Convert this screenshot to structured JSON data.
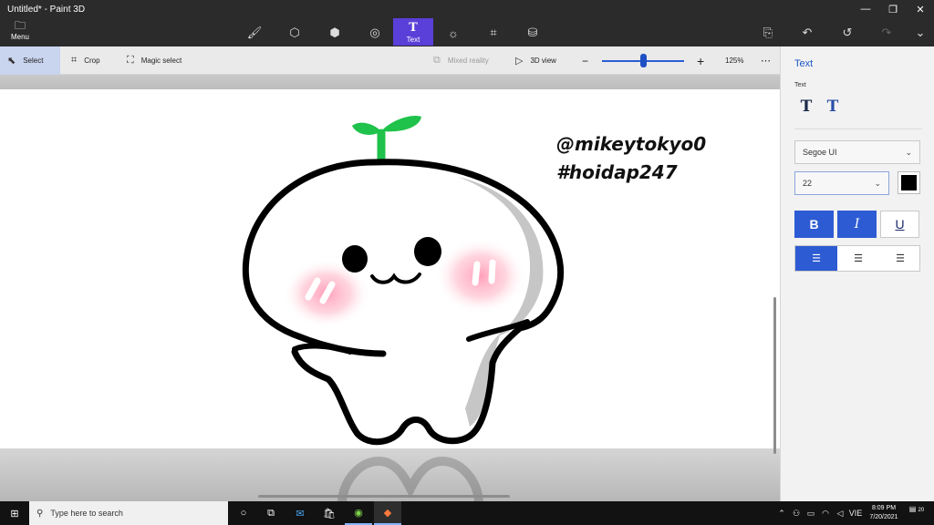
{
  "window": {
    "title": "Untitled* - Paint 3D",
    "menu_label": "Menu",
    "active_tool_label": "Text"
  },
  "toolbar": {
    "select": "Select",
    "crop": "Crop",
    "magic_select": "Magic select",
    "mixed_reality": "Mixed reality",
    "view_3d": "3D view",
    "zoom": "125%",
    "zoom_level": 0.47
  },
  "canvas": {
    "text_lines": [
      "@mikeytokyo0",
      "#hoidap247"
    ]
  },
  "panel": {
    "title": "Text",
    "subtitle": "Text",
    "font": "Segoe UI",
    "size": "22",
    "bold": "B",
    "italic": "I",
    "underline": "U",
    "color": "#000000"
  },
  "taskbar": {
    "search_placeholder": "Type here to search",
    "language": "VIE",
    "time": "8:09 PM",
    "date": "7/20/2021",
    "notifications": "20"
  },
  "colors": {
    "accent": "#5a3fd8",
    "selection_blue": "#2d5bd3",
    "blush": "#ff9bb5",
    "sprout": "#1fc24a"
  }
}
